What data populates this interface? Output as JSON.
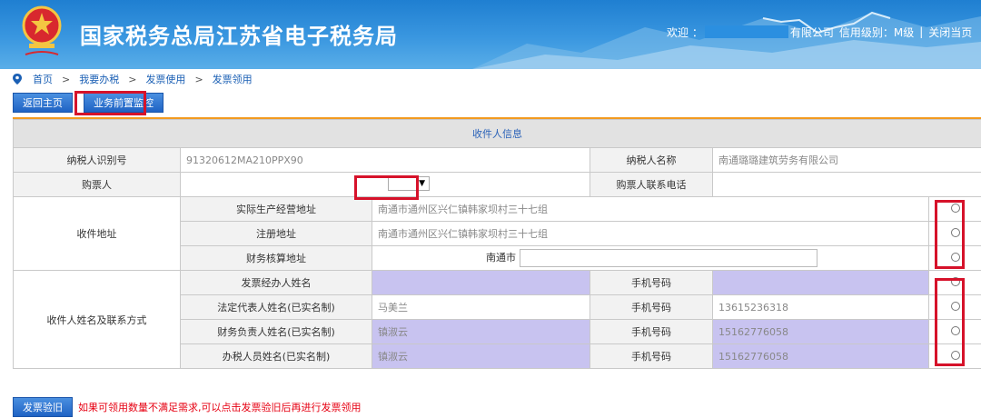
{
  "header": {
    "title": "国家税务总局江苏省电子税务局",
    "welcome": "欢迎 ：",
    "company_suffix": "有限公司",
    "credit_label": "信用级别：M级",
    "separator": "|",
    "close": "关闭当页"
  },
  "breadcrumb": {
    "items": [
      "首页",
      "我要办税",
      "发票使用",
      "发票领用"
    ],
    "arrow": ">"
  },
  "buttons": {
    "back_home": "返回主页",
    "monitor": "业务前置监控",
    "invoice_check": "发票验旧"
  },
  "form": {
    "section_title": "收件人信息",
    "taxpayer_id_label": "纳税人识别号",
    "taxpayer_id_value": "91320612MA210PPX90",
    "taxpayer_name_label": "纳税人名称",
    "taxpayer_name_value": "南通璐璐建筑劳务有限公司",
    "buyer_label": "购票人",
    "buyer_phone_label": "购票人联系电话",
    "address_group_label": "收件地址",
    "actual_address_label": "实际生产经营地址",
    "actual_address_value": "南通市通州区兴仁镇韩家坝村三十七组",
    "reg_address_label": "注册地址",
    "reg_address_value": "南通市通州区兴仁镇韩家坝村三十七组",
    "finance_address_label": "财务核算地址",
    "finance_address_city": "南通市",
    "contact_group_label": "收件人姓名及联系方式",
    "phone_label": "手机号码",
    "handler_label": "发票经办人姓名",
    "legal_rep_label": "法定代表人姓名(已实名制)",
    "legal_rep_name": "马美兰",
    "legal_rep_phone": "13615236318",
    "finance_head_label": "财务负责人姓名(已实名制)",
    "finance_head_name": "镇淑云",
    "finance_head_phone": "15162776058",
    "tax_officer_label": "办税人员姓名(已实名制)",
    "tax_officer_name": "镇淑云",
    "tax_officer_phone": "15162776058"
  },
  "hint": "如果可领用数量不满足需求,可以点击发票验旧后再进行发票领用",
  "colors": {
    "header_blue": "#2a8ad8",
    "highlight_red": "#d6122a",
    "purple_cell": "#c8c3f0",
    "section_title_blue": "#2a62b8",
    "hint_red": "#e60012",
    "orange_line": "#f29a1f"
  }
}
